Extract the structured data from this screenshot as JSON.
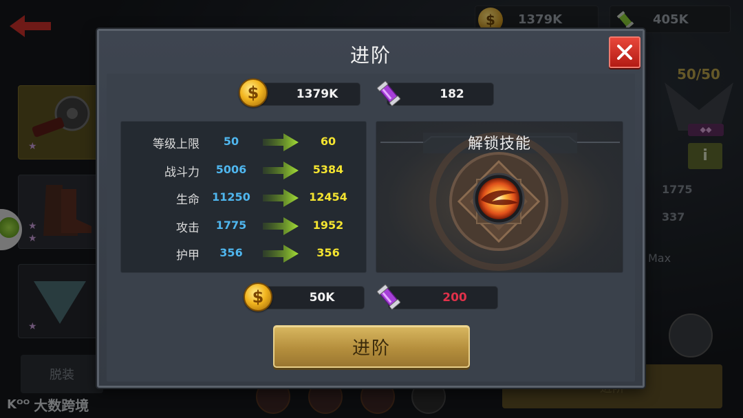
{
  "background": {
    "gold_value": "1379K",
    "tube_value": "405K",
    "unequip_label": "脱装",
    "level_display": "50/50",
    "stat_attack": "1775",
    "stat_armor": "337",
    "max_label": "Max",
    "info_icon_label": "i",
    "advance_label": "进阶",
    "watermark_text": "大数跨境",
    "watermark_logo": "Kᴼᴼ"
  },
  "modal": {
    "title": "进阶",
    "owned": {
      "gold": "1379K",
      "tube": "182"
    },
    "stats": [
      {
        "label": "等级上限",
        "old": "50",
        "new": "60"
      },
      {
        "label": "战斗力",
        "old": "5006",
        "new": "5384"
      },
      {
        "label": "生命",
        "old": "11250",
        "new": "12454"
      },
      {
        "label": "攻击",
        "old": "1775",
        "new": "1952"
      },
      {
        "label": "护甲",
        "old": "356",
        "new": "356"
      }
    ],
    "skill_panel_title": "解锁技能",
    "cost": {
      "gold": "50K",
      "tube": "200"
    },
    "advance_button": "进阶",
    "coin_symbol": "$"
  },
  "colors": {
    "old_value": "#4fb6ee",
    "new_value": "#f4e430",
    "insufficient": "#e0314a",
    "close_button": "#d0342a",
    "advance_button": "#c9a44e"
  },
  "icons": [
    "back-arrow-icon",
    "coin-icon",
    "tube-icon",
    "close-icon",
    "right-arrow-icon",
    "skill-icon"
  ]
}
